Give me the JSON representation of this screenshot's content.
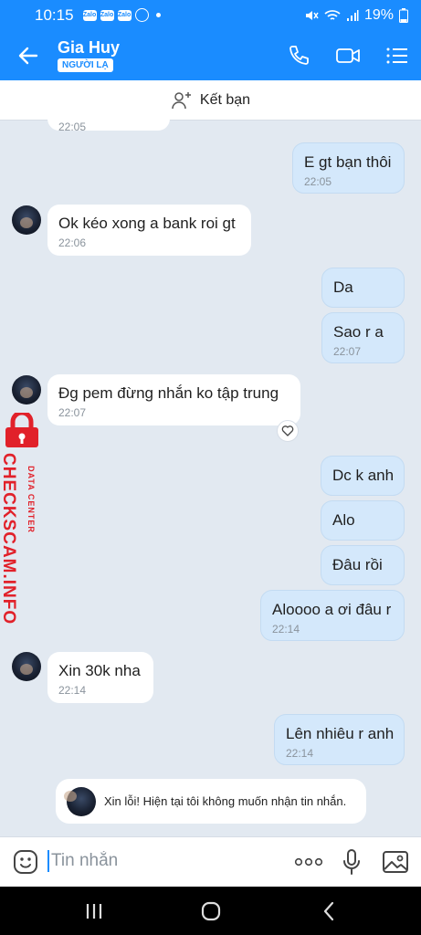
{
  "status_bar": {
    "time": "10:15",
    "app_icons": [
      "Zalo",
      "Zalo",
      "Zalo"
    ],
    "battery": "19%"
  },
  "header": {
    "contact_name": "Gia Huy",
    "badge": "NGƯỜI LẠ"
  },
  "add_friend": {
    "label": "Kết bạn"
  },
  "messages": [
    {
      "direction": "in",
      "text": "",
      "time": "22:05"
    },
    {
      "direction": "out",
      "text": "E gt bạn thôi",
      "time": "22:05"
    },
    {
      "direction": "in",
      "text": "Ok kéo xong a bank roi gt",
      "time": "22:06"
    },
    {
      "direction": "out",
      "text": "Da",
      "time": ""
    },
    {
      "direction": "out",
      "text": "Sao r a",
      "time": "22:07"
    },
    {
      "direction": "in",
      "text": "Đg pem đừng nhắn ko tập trung",
      "time": "22:07"
    },
    {
      "direction": "out",
      "text": "Dc k anh",
      "time": ""
    },
    {
      "direction": "out",
      "text": "Alo",
      "time": ""
    },
    {
      "direction": "out",
      "text": "Đâu rồi",
      "time": ""
    },
    {
      "direction": "out",
      "text": "Aloooo a ơi đâu r",
      "time": "22:14"
    },
    {
      "direction": "in",
      "text": "Xin 30k nha",
      "time": "22:14"
    },
    {
      "direction": "out",
      "text": "Lên nhiêu r anh",
      "time": "22:14"
    }
  ],
  "notice": {
    "text": "Xin lỗi! Hiện tại tôi không muốn nhận tin nhắn."
  },
  "composer": {
    "placeholder": "Tin nhắn"
  },
  "watermark": {
    "main": "CHECKSCAM.INFO",
    "sub": "DATA CENTER"
  },
  "colors": {
    "brand": "#1a8cff",
    "incoming_bubble": "#ffffff",
    "outgoing_bubble": "#d4e8fb",
    "watermark": "#e1212a"
  }
}
